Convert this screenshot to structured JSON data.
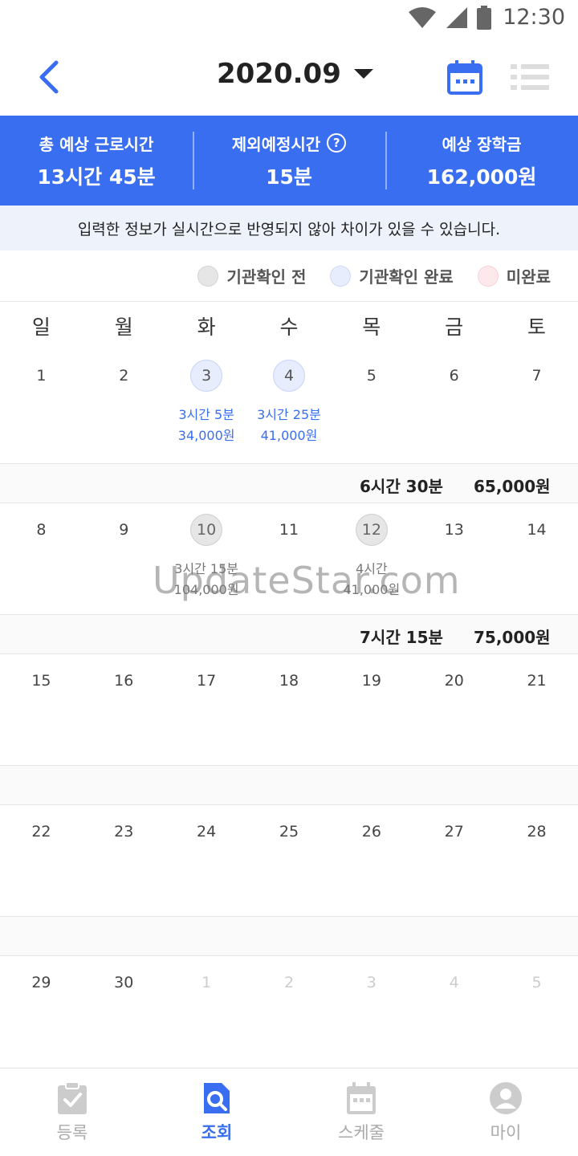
{
  "status": {
    "time": "12:30"
  },
  "header": {
    "month": "2020.09"
  },
  "summary": [
    {
      "label": "총 예상 근로시간",
      "value": "13시간 45분"
    },
    {
      "label": "제외예정시간",
      "value": "15분",
      "help_icon": "?"
    },
    {
      "label": "예상 장학금",
      "value": "162,000원"
    }
  ],
  "notice": "입력한 정보가 실시간으로 반영되지 않아 차이가 있을 수 있습니다.",
  "legend": [
    {
      "label": "기관확인 전",
      "color": "#e6e6e6"
    },
    {
      "label": "기관확인 완료",
      "color": "#e7edfd"
    },
    {
      "label": "미완료",
      "color": "#fde8ec"
    }
  ],
  "weekdays": [
    "일",
    "월",
    "화",
    "수",
    "목",
    "금",
    "토"
  ],
  "weeks": [
    {
      "days": [
        {
          "num": "1"
        },
        {
          "num": "2"
        },
        {
          "num": "3",
          "state": "blue",
          "time": "3시간 5분",
          "pay": "34,000원"
        },
        {
          "num": "4",
          "state": "blue",
          "time": "3시간 25분",
          "pay": "41,000원"
        },
        {
          "num": "5"
        },
        {
          "num": "6"
        },
        {
          "num": "7"
        }
      ],
      "summary": {
        "time": "6시간 30분",
        "pay": "65,000원"
      }
    },
    {
      "days": [
        {
          "num": "8"
        },
        {
          "num": "9"
        },
        {
          "num": "10",
          "state": "gray",
          "time": "3시간 15분",
          "pay": "104,000원"
        },
        {
          "num": "11"
        },
        {
          "num": "12",
          "state": "gray",
          "time": "4시간",
          "pay": "41,000원"
        },
        {
          "num": "13"
        },
        {
          "num": "14"
        }
      ],
      "summary": {
        "time": "7시간 15분",
        "pay": "75,000원"
      }
    },
    {
      "days": [
        {
          "num": "15"
        },
        {
          "num": "16"
        },
        {
          "num": "17"
        },
        {
          "num": "18"
        },
        {
          "num": "19"
        },
        {
          "num": "20"
        },
        {
          "num": "21"
        }
      ],
      "summary": {
        "time": "",
        "pay": ""
      }
    },
    {
      "days": [
        {
          "num": "22"
        },
        {
          "num": "23"
        },
        {
          "num": "24"
        },
        {
          "num": "25"
        },
        {
          "num": "26"
        },
        {
          "num": "27"
        },
        {
          "num": "28"
        }
      ],
      "summary": {
        "time": "",
        "pay": ""
      }
    },
    {
      "days": [
        {
          "num": "29"
        },
        {
          "num": "30"
        },
        {
          "num": "1",
          "muted": true
        },
        {
          "num": "2",
          "muted": true
        },
        {
          "num": "3",
          "muted": true
        },
        {
          "num": "4",
          "muted": true
        },
        {
          "num": "5",
          "muted": true
        }
      ]
    }
  ],
  "watermark": "UpdateStar.com",
  "nav": [
    {
      "label": "등록",
      "icon": "clipboard-check-icon"
    },
    {
      "label": "조회",
      "icon": "search-doc-icon",
      "active": true
    },
    {
      "label": "스케줄",
      "icon": "calendar-icon"
    },
    {
      "label": "마이",
      "icon": "profile-icon"
    }
  ],
  "colors": {
    "accent": "#3a6ef0",
    "notice_bg": "#eef2fb"
  }
}
